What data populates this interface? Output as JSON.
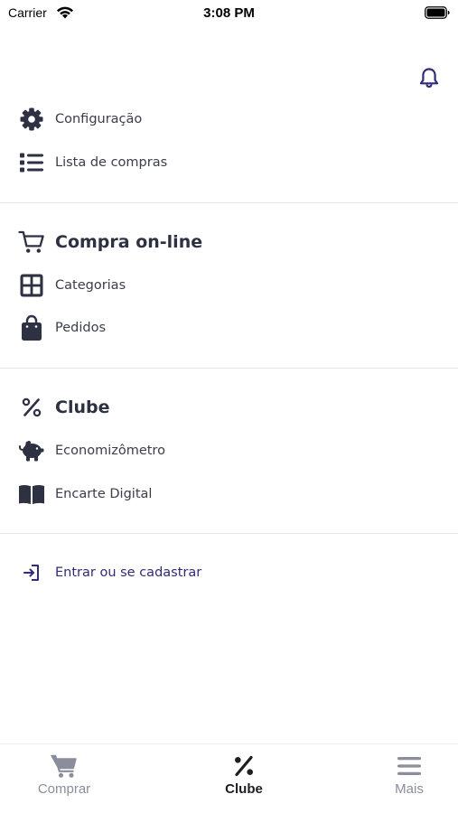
{
  "status_bar": {
    "carrier": "Carrier",
    "time": "3:08 PM"
  },
  "colors": {
    "accent": "#302b7a",
    "icon": "#2d3142",
    "inactive": "#8a8e9c"
  },
  "menu": {
    "top_items": [
      {
        "label": "Configuração",
        "icon": "gear-icon"
      },
      {
        "label": "Lista de compras",
        "icon": "list-icon"
      }
    ],
    "online_section": {
      "title": "Compra on-line",
      "icon": "cart-outline-icon",
      "items": [
        {
          "label": "Categorias",
          "icon": "grid-icon"
        },
        {
          "label": "Pedidos",
          "icon": "shopping-bag-icon"
        }
      ]
    },
    "club_section": {
      "title": "Clube",
      "icon": "percent-icon",
      "items": [
        {
          "label": "Economizômetro",
          "icon": "piggy-bank-icon"
        },
        {
          "label": "Encarte Digital",
          "icon": "open-book-icon"
        }
      ]
    },
    "login": {
      "label": "Entrar ou se cadastrar",
      "icon": "sign-in-icon"
    }
  },
  "tab_bar": {
    "tabs": [
      {
        "label": "Comprar",
        "icon": "cart-icon",
        "active": false
      },
      {
        "label": "Clube",
        "icon": "percent-icon",
        "active": true
      },
      {
        "label": "Mais",
        "icon": "hamburger-icon",
        "active": false
      }
    ]
  }
}
